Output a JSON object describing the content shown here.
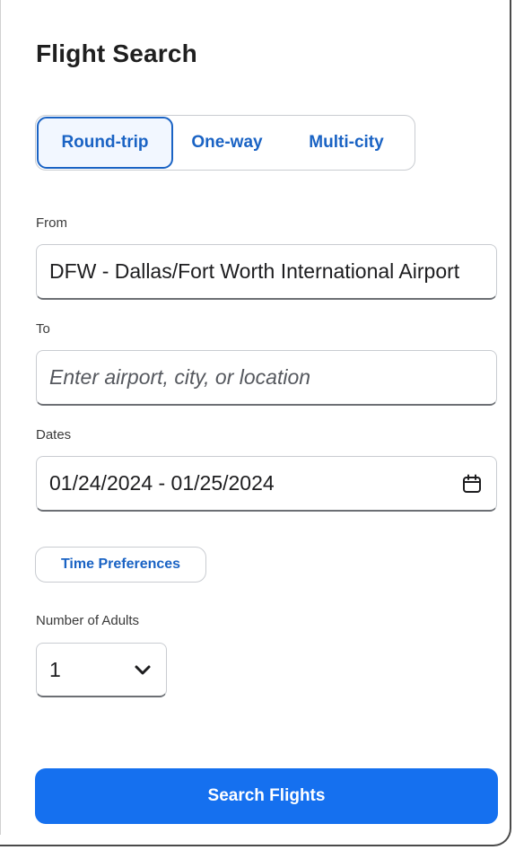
{
  "panel": {
    "title": "Flight Search"
  },
  "trip_type": {
    "options": [
      {
        "label": "Round-trip",
        "selected": true
      },
      {
        "label": "One-way",
        "selected": false
      },
      {
        "label": "Multi-city",
        "selected": false
      }
    ]
  },
  "from": {
    "label": "From",
    "value": "DFW - Dallas/Fort Worth International Airport"
  },
  "to": {
    "label": "To",
    "value": "",
    "placeholder": "Enter airport, city, or location"
  },
  "dates": {
    "label": "Dates",
    "value": "01/24/2024 - 01/25/2024",
    "icon": "calendar-icon"
  },
  "time_preferences": {
    "label": "Time Preferences"
  },
  "adults": {
    "label": "Number of Adults",
    "value": "1",
    "icon": "chevron-down-icon"
  },
  "search_button": {
    "label": "Search Flights"
  },
  "colors": {
    "accent": "#1a63c4",
    "primary_button": "#1570ef"
  }
}
